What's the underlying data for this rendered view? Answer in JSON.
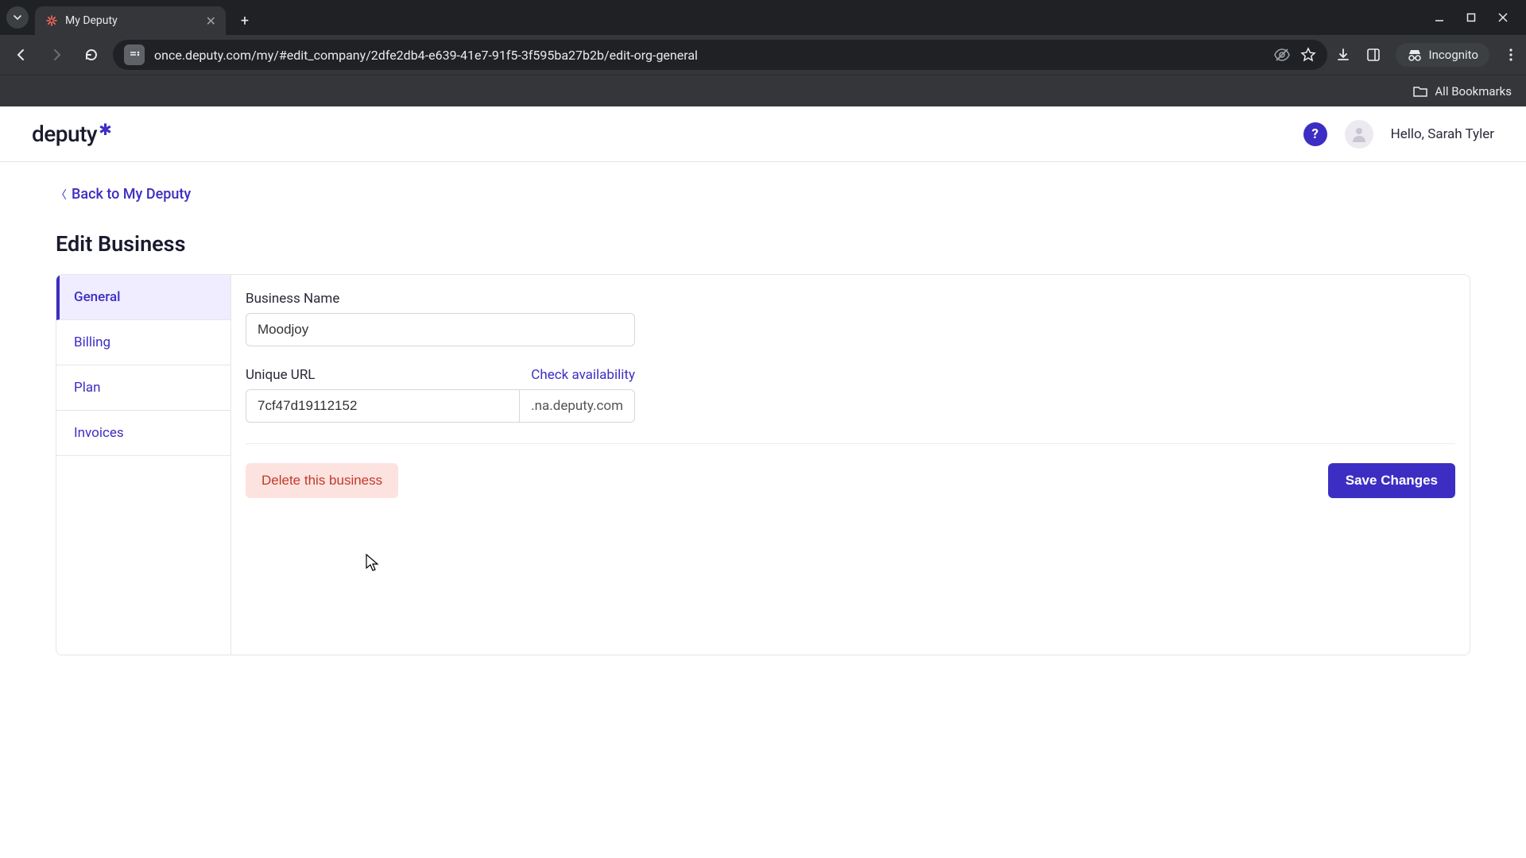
{
  "browser": {
    "tab_title": "My Deputy",
    "url": "once.deputy.com/my/#edit_company/2dfe2db4-e639-41e7-91f5-3f595ba27b2b/edit-org-general",
    "incognito_label": "Incognito",
    "bookmarks_label": "All Bookmarks"
  },
  "header": {
    "logo_text": "deputy",
    "help_label": "?",
    "greeting": "Hello, Sarah Tyler"
  },
  "page": {
    "back_link": "Back to My Deputy",
    "title": "Edit Business"
  },
  "tabs": {
    "general": "General",
    "billing": "Billing",
    "plan": "Plan",
    "invoices": "Invoices"
  },
  "form": {
    "business_name_label": "Business Name",
    "business_name_value": "Moodjoy",
    "unique_url_label": "Unique URL",
    "check_availability": "Check availability",
    "unique_url_value": "7cf47d19112152",
    "url_suffix": ".na.deputy.com",
    "delete_label": "Delete this business",
    "save_label": "Save Changes"
  }
}
